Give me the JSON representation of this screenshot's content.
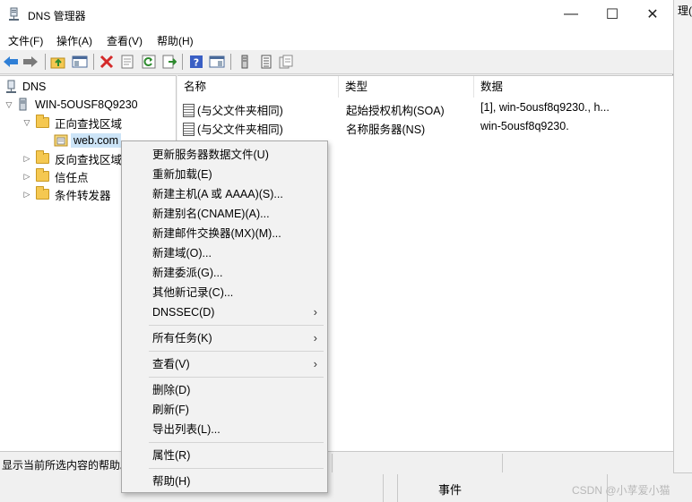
{
  "window": {
    "title": "DNS 管理器",
    "min_glyph": "—",
    "max_glyph": "☐",
    "close_glyph": "✕"
  },
  "menubar": [
    "文件(F)",
    "操作(A)",
    "查看(V)",
    "帮助(H)"
  ],
  "tree": {
    "root": "DNS",
    "server": "WIN-5OUSF8Q9230",
    "forward_zones": "正向查找区域",
    "zone": "web.com",
    "reverse_zones": "反向查找区域",
    "trust_points": "信任点",
    "conditional_forwarders": "条件转发器"
  },
  "list": {
    "columns": [
      "名称",
      "类型",
      "数据"
    ],
    "rows": [
      {
        "name": "(与父文件夹相同)",
        "type": "起始授权机构(SOA)",
        "data": "[1], win-5ousf8q9230., h..."
      },
      {
        "name": "(与父文件夹相同)",
        "type": "名称服务器(NS)",
        "data": "win-5ousf8q9230."
      }
    ]
  },
  "status_text": "显示当前所选内容的帮助。",
  "context_menu": {
    "items": [
      "更新服务器数据文件(U)",
      "重新加载(E)",
      "新建主机(A 或 AAAA)(S)...",
      "新建别名(CNAME)(A)...",
      "新建邮件交换器(MX)(M)...",
      "新建域(O)...",
      "新建委派(G)...",
      "其他新记录(C)...",
      "DNSSEC(D)",
      "所有任务(K)",
      "查看(V)",
      "删除(D)",
      "刷新(F)",
      "导出列表(L)...",
      "属性(R)",
      "帮助(H)"
    ],
    "submenu_arrow": "›"
  },
  "background": {
    "right_title_fragment": "理(M",
    "events_label": "事件"
  },
  "watermark": "CSDN @小莩爱小猫",
  "colors": {
    "selection": "#cce4f7",
    "folder": "#f5c851",
    "menu_bg": "#f2f2f2"
  },
  "toolbar_icons": [
    "back-arrow-icon",
    "forward-arrow-icon",
    "folder-up-icon",
    "show-hide-tree-icon",
    "delete-icon",
    "properties-icon",
    "refresh-icon",
    "export-list-icon",
    "help-icon",
    "show-hide-action-pane-icon",
    "server-icon",
    "zone-list-icon",
    "records-icon"
  ]
}
